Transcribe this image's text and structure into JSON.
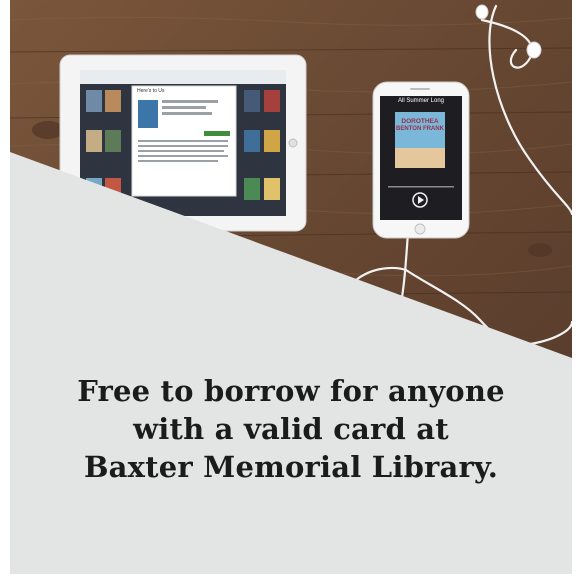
{
  "caption": {
    "line1": "Free to borrow for anyone",
    "line2": "with a valid card at",
    "line3": "Baxter Memorial Library."
  },
  "tablet": {
    "popup_title": "Here's to Us"
  },
  "phone": {
    "now_playing": "All Summer Long",
    "cover_author_line1": "DOROTHEA",
    "cover_author_line2": "BENTON FRANK"
  },
  "colors": {
    "wood": "#6b4a33",
    "panel": "#e3e4e4",
    "caption_text": "#1b1b1b"
  }
}
